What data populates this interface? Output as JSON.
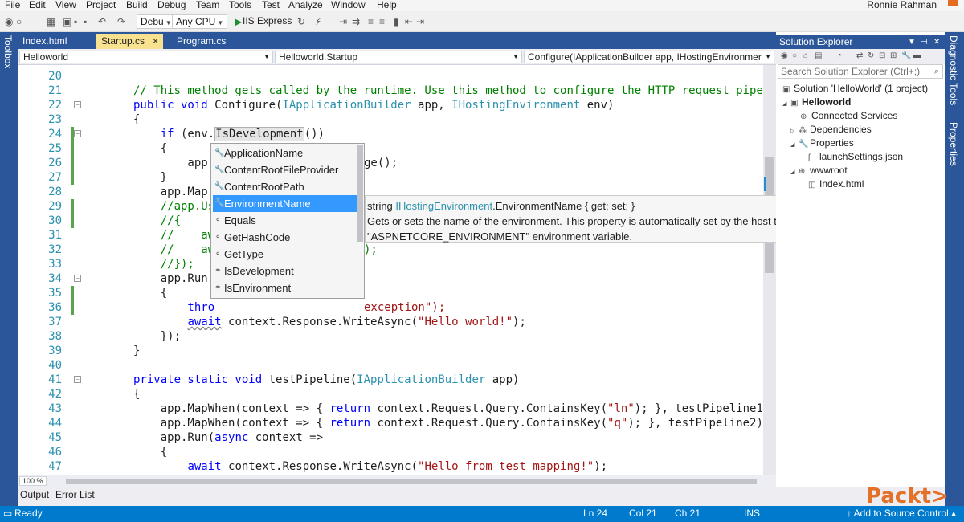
{
  "menubar": {
    "items": [
      "File",
      "Edit",
      "View",
      "Project",
      "Build",
      "Debug",
      "Team",
      "Tools",
      "Test",
      "Analyze",
      "Window",
      "Help"
    ],
    "user": "Ronnie Rahman"
  },
  "toolbar": {
    "config": "Debu",
    "platform": "Any CPU",
    "run_target": "IIS Express"
  },
  "left_strip": {
    "label": "Toolbox"
  },
  "right_strip": {
    "tab1": "Diagnostic Tools",
    "tab2": "Properties"
  },
  "tabs": [
    {
      "label": "Index.html"
    },
    {
      "label": "Startup.cs",
      "close": "×"
    },
    {
      "label": "Program.cs"
    }
  ],
  "nav": {
    "project": "Helloworld",
    "class": "Helloworld.Startup",
    "member": "Configure(IApplicationBuilder app, IHostingEnvironmer"
  },
  "editor": {
    "lines": [
      {
        "n": "20",
        "t": ""
      },
      {
        "n": "21",
        "t": "// This method gets called by the runtime. Use this method to configure the HTTP request pipelin"
      },
      {
        "n": "22",
        "t": "public void Configure(IApplicationBuilder app, IHostingEnvironment env)"
      },
      {
        "n": "23",
        "t": "{"
      },
      {
        "n": "24",
        "t": "    if (env.IsDevelopment())"
      },
      {
        "n": "25",
        "t": "    {"
      },
      {
        "n": "26",
        "t": "        app."
      },
      {
        "n": "27",
        "t": "    }"
      },
      {
        "n": "28",
        "t": "    app.Map("
      },
      {
        "n": "29",
        "t": "    //app.Us"
      },
      {
        "n": "30",
        "t": "    //{"
      },
      {
        "n": "31",
        "t": "    //    aw"
      },
      {
        "n": "32",
        "t": "    //    aw"
      },
      {
        "n": "33",
        "t": "    //});"
      },
      {
        "n": "34",
        "t": "    app.Run("
      },
      {
        "n": "35",
        "t": "    {"
      },
      {
        "n": "36",
        "t": "        thro"
      },
      {
        "n": "37",
        "t": "        await context.Response.WriteAsync(\"Hello world!\");"
      },
      {
        "n": "38",
        "t": "    });"
      },
      {
        "n": "39",
        "t": "}"
      },
      {
        "n": "40",
        "t": ""
      },
      {
        "n": "41",
        "t": "private static void testPipeline(IApplicationBuilder app)"
      },
      {
        "n": "42",
        "t": "{"
      },
      {
        "n": "43",
        "t": "    app.MapWhen(context => { return context.Request.Query.ContainsKey(\"ln\"); }, testPipeline1);"
      },
      {
        "n": "44",
        "t": "    app.MapWhen(context => { return context.Request.Query.ContainsKey(\"q\"); }, testPipeline2);"
      },
      {
        "n": "45",
        "t": "    app.Run(async context =>"
      },
      {
        "n": "46",
        "t": "    {"
      },
      {
        "n": "47",
        "t": "        await context.Response.WriteAsync(\"Hello from test mapping!\");"
      }
    ],
    "fragments": {
      "line26_tail": "ge();",
      "line32_tail": ");",
      "line36_tail": "exception\");"
    },
    "zoom": "100 %"
  },
  "completion": {
    "items": [
      {
        "label": "ApplicationName",
        "icon": "wrench-icon"
      },
      {
        "label": "ContentRootFileProvider",
        "icon": "wrench-icon"
      },
      {
        "label": "ContentRootPath",
        "icon": "wrench-icon"
      },
      {
        "label": "EnvironmentName",
        "icon": "wrench-icon"
      },
      {
        "label": "Equals",
        "icon": "method-icon"
      },
      {
        "label": "GetHashCode",
        "icon": "method-icon"
      },
      {
        "label": "GetType",
        "icon": "method-icon"
      },
      {
        "label": "IsDevelopment",
        "icon": "extension-method-icon"
      },
      {
        "label": "IsEnvironment",
        "icon": "extension-method-icon"
      }
    ],
    "selected_index": 3
  },
  "tooltip": {
    "line1_pre": "string ",
    "line1_type": "IHostingEnvironment",
    "line1_post": ".EnvironmentName { get; set; }",
    "line2": "Gets or sets the name of the environment. This property is automatically set by the host to the value of the",
    "line3": "\"ASPNETCORE_ENVIRONMENT\" environment variable."
  },
  "solution_explorer": {
    "title": "Solution Explorer",
    "search_placeholder": "Search Solution Explorer (Ctrl+;)",
    "items": [
      {
        "label": "Solution 'HelloWorld' (1 project)",
        "level": 0,
        "icon": "solution-icon"
      },
      {
        "label": "Helloworld",
        "level": 1,
        "icon": "web-project-icon",
        "expander": "◢",
        "bold": true
      },
      {
        "label": "Connected Services",
        "level": 2,
        "icon": "connected-services-icon"
      },
      {
        "label": "Dependencies",
        "level": 2,
        "icon": "dependencies-icon",
        "expander": "▷"
      },
      {
        "label": "Properties",
        "level": 2,
        "icon": "wrench-icon",
        "expander": "◢"
      },
      {
        "label": "launchSettings.json",
        "level": 3,
        "icon": "json-file-icon"
      },
      {
        "label": "wwwroot",
        "level": 2,
        "icon": "globe-icon",
        "expander": "◢"
      },
      {
        "label": "Index.html",
        "level": 3,
        "icon": "html-file-icon"
      }
    ]
  },
  "bottom_tabs": [
    "Output",
    "Error List"
  ],
  "status": {
    "ready": "Ready",
    "ln": "Ln 24",
    "col": "Col 21",
    "ch": "Ch 21",
    "ins": "INS",
    "source_control": "↑ Add to Source Control ▴"
  },
  "logo": "Packt>",
  "colors": {
    "accent": "#2b579a",
    "statusbar": "#007acc",
    "active_tab": "#f9e28f",
    "selection": "#3399ff",
    "brand": "#e4712a"
  }
}
